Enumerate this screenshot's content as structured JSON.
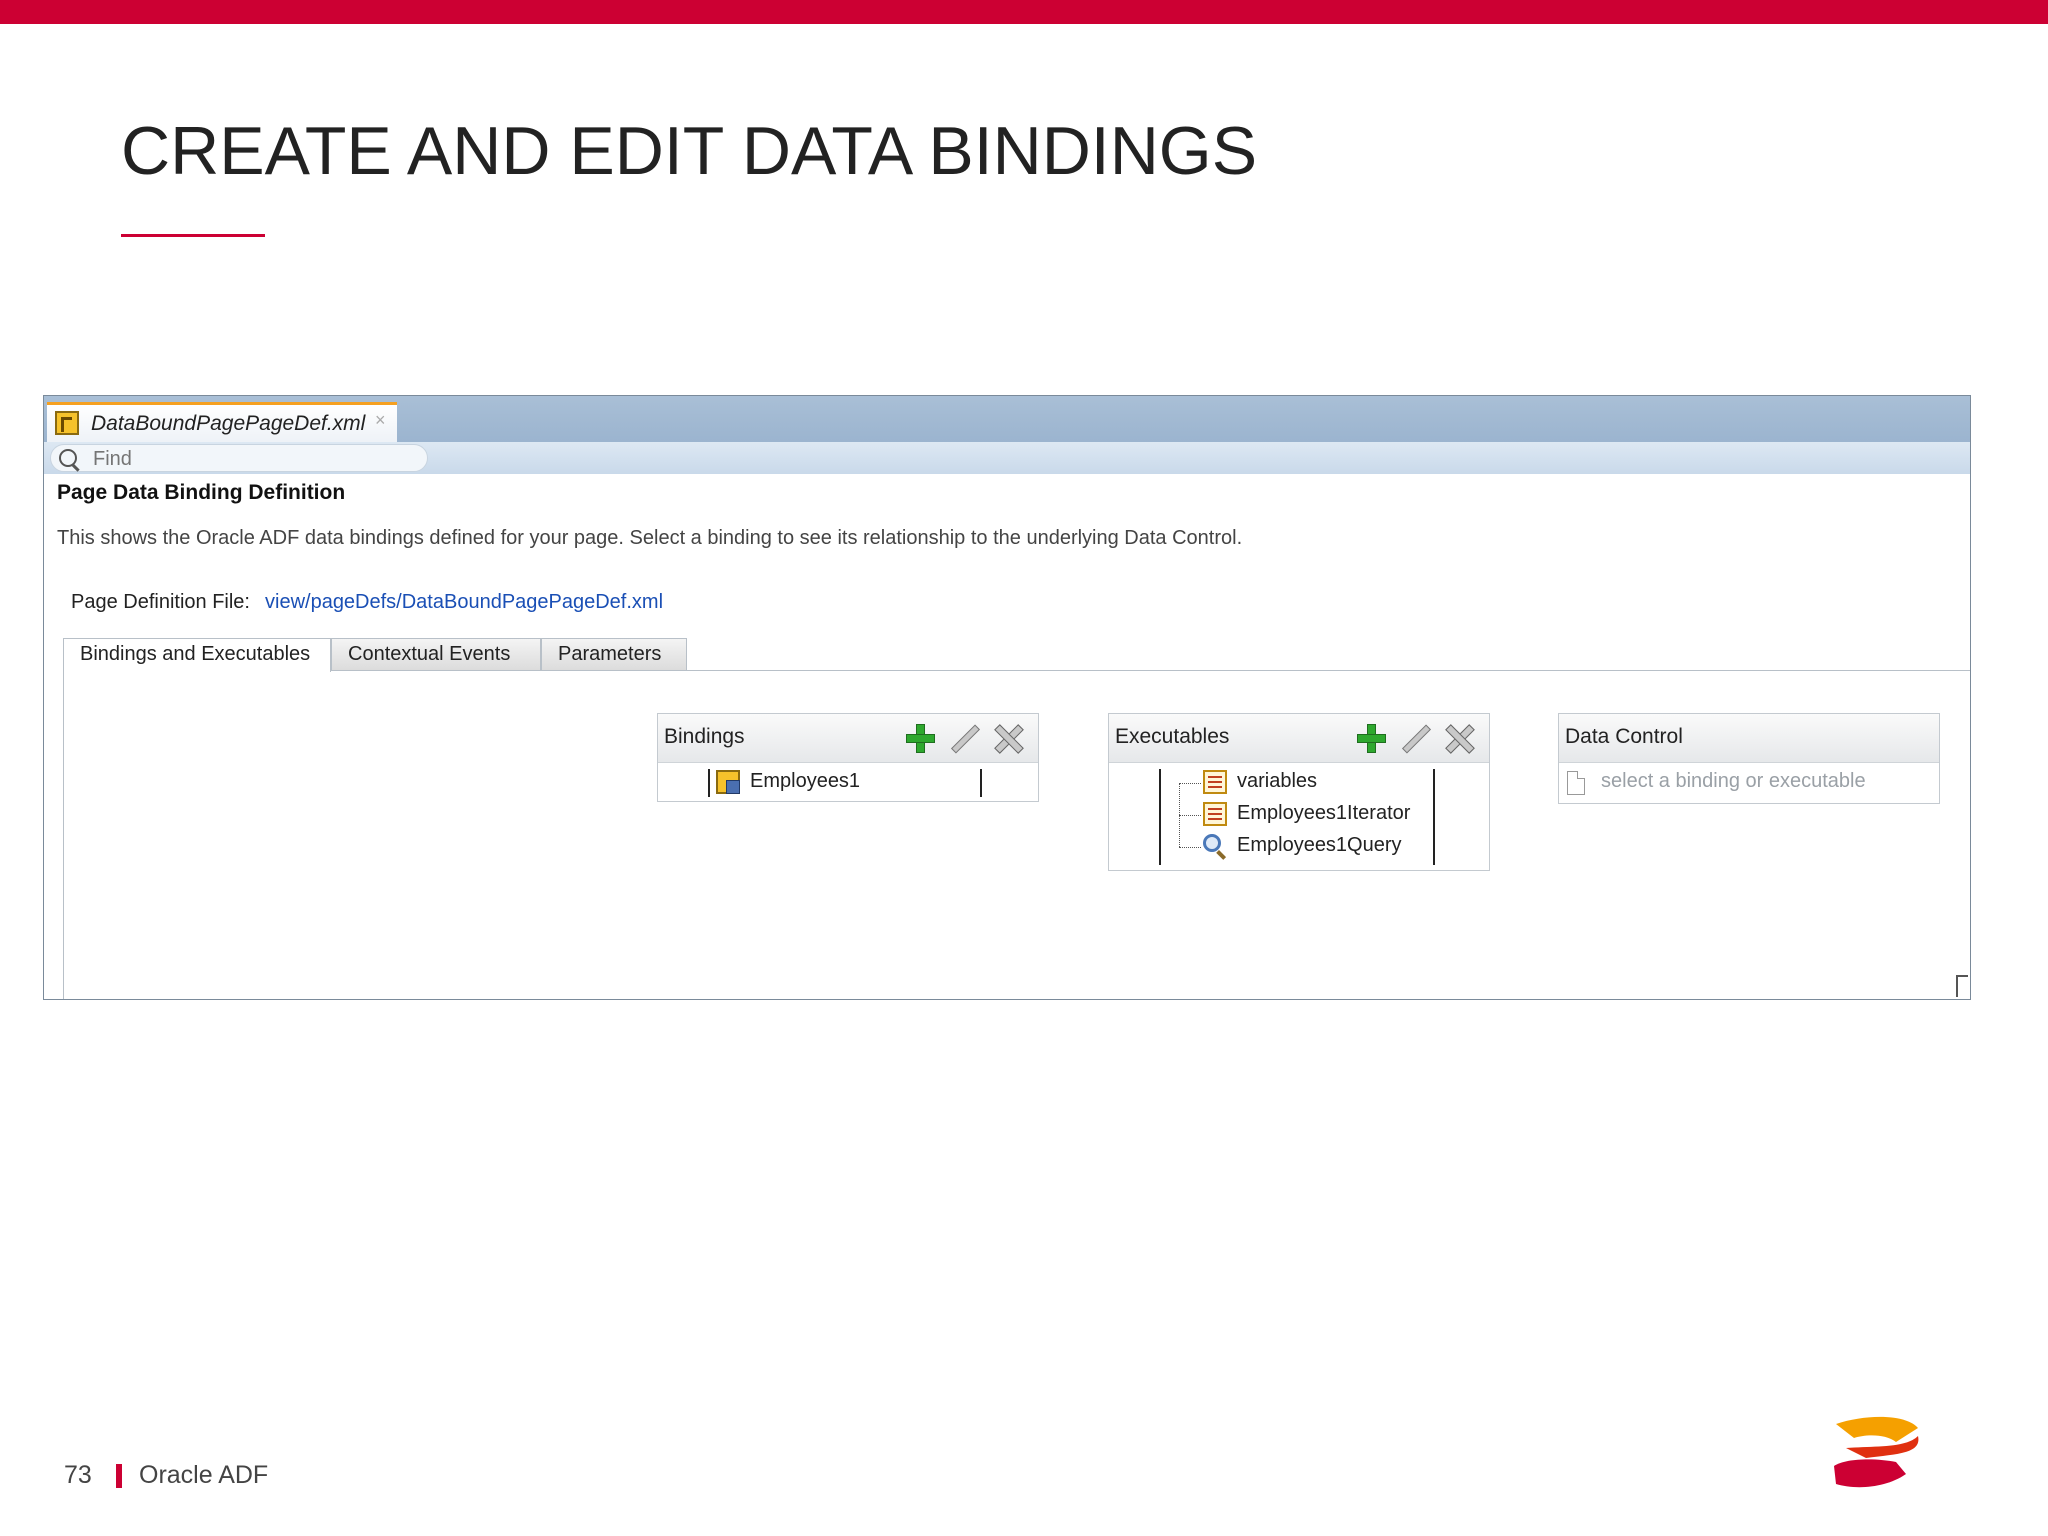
{
  "slide": {
    "title": "CREATE AND EDIT DATA BINDINGS",
    "page_number": "73",
    "footer_text": "Oracle ADF",
    "accent_color": "#cc0033"
  },
  "editor": {
    "file_tab_label": "DataBoundPagePageDef.xml",
    "find_placeholder": "Find",
    "heading": "Page Data Binding Definition",
    "description": "This shows the Oracle ADF data bindings defined for your page. Select a binding to see its relationship to the underlying Data Control.",
    "page_def_label": "Page Definition File:",
    "page_def_link": "view/pageDefs/DataBoundPagePageDef.xml",
    "tabs": [
      {
        "label": "Bindings and Executables",
        "active": true
      },
      {
        "label": "Contextual Events",
        "active": false
      },
      {
        "label": "Parameters",
        "active": false
      }
    ]
  },
  "bindings_panel": {
    "title": "Bindings",
    "items": [
      {
        "label": "Employees1",
        "icon": "attribute-binding-icon"
      }
    ]
  },
  "executables_panel": {
    "title": "Executables",
    "items": [
      {
        "label": "variables",
        "icon": "iterator-icon"
      },
      {
        "label": "Employees1Iterator",
        "icon": "iterator-icon"
      },
      {
        "label": "Employees1Query",
        "icon": "query-icon"
      }
    ]
  },
  "data_control_panel": {
    "title": "Data Control",
    "placeholder": "select a binding or executable"
  }
}
